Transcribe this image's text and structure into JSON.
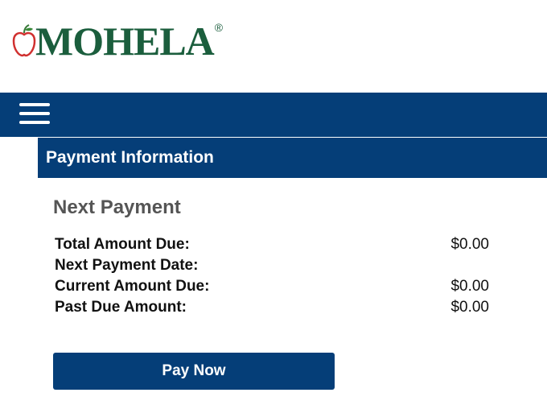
{
  "brand": {
    "logo_text": "MOHELA",
    "logo_mark": "®",
    "logo_icon": "apple-icon",
    "primary_color": "#053e78",
    "logo_color": "#1b5e3d",
    "apple_color": "#d0302f"
  },
  "nav": {
    "menu_icon": "hamburger-menu-icon"
  },
  "section": {
    "title": "Payment Information"
  },
  "next_payment": {
    "title": "Next Payment",
    "rows": [
      {
        "label": "Total Amount Due:",
        "value": "$0.00"
      },
      {
        "label": "Next Payment Date:",
        "value": ""
      },
      {
        "label": "Current Amount Due:",
        "value": "$0.00"
      },
      {
        "label": "Past Due Amount:",
        "value": "$0.00"
      }
    ]
  },
  "actions": {
    "pay_now_label": "Pay Now"
  }
}
